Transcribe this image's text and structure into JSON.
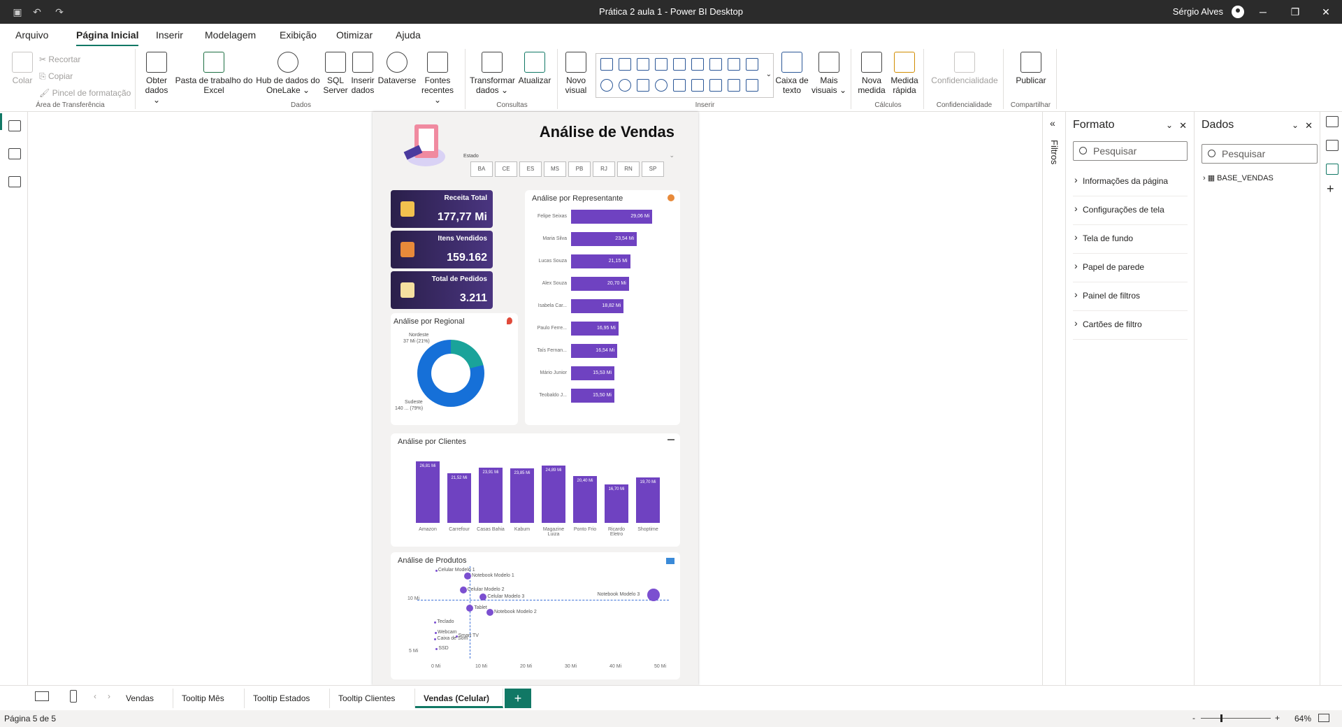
{
  "window": {
    "title": "Prática 2 aula 1 - Power BI Desktop",
    "user": "Sérgio Alves"
  },
  "menu": [
    "Arquivo",
    "Página Inicial",
    "Inserir",
    "Modelagem",
    "Exibição",
    "Otimizar",
    "Ajuda"
  ],
  "ribbon": {
    "clipboard": {
      "colar": "Colar",
      "recortar": "Recortar",
      "copiar": "Copiar",
      "pincel": "Pincel de formatação",
      "label": "Área de Transferência"
    },
    "dados": {
      "obter": "Obter dados ⌄",
      "excel": "Pasta de trabalho do Excel",
      "onelake": "Hub de dados do OneLake ⌄",
      "sql": "SQL Server",
      "inserir": "Inserir dados",
      "dataverse": "Dataverse",
      "fontes": "Fontes recentes ⌄",
      "label": "Dados"
    },
    "consultas": {
      "transformar": "Transformar dados ⌄",
      "atualizar": "Atualizar",
      "label": "Consultas"
    },
    "inserir": {
      "novo_visual": "Novo visual",
      "caixa": "Caixa de texto",
      "mais": "Mais visuais ⌄",
      "label": "Inserir"
    },
    "calculos": {
      "nova": "Nova medida",
      "rapida": "Medida rápida",
      "label": "Cálculos"
    },
    "confidencialidade": {
      "btn": "Confidencialidade",
      "label": "Confidencialidade"
    },
    "compartilhar": {
      "publicar": "Publicar",
      "label": "Compartilhar"
    }
  },
  "report": {
    "title": "Análise de Vendas",
    "estado_label": "Estado",
    "estados": [
      "BA",
      "CE",
      "ES",
      "MS",
      "PB",
      "RJ",
      "RN",
      "SP"
    ],
    "kpis": [
      {
        "label": "Receita Total",
        "value": "177,77 Mi"
      },
      {
        "label": "Itens Vendidos",
        "value": "159.162"
      },
      {
        "label": "Total de Pedidos",
        "value": "3.211"
      }
    ],
    "regional": {
      "title": "Análise por Regional",
      "nordeste_name": "Nordeste",
      "nordeste_value": "37 Mi (21%)",
      "sudeste_name": "Sudeste",
      "sudeste_value": "140 ... (79%)"
    },
    "representante": {
      "title": "Análise por Representante"
    },
    "clientes_title": "Análise por Clientes",
    "produtos": {
      "title": "Análise de Produtos",
      "y_ticks": [
        "10 Mi",
        "5 Mi"
      ],
      "x_ticks": [
        "0 Mi",
        "10 Mi",
        "20 Mi",
        "30 Mi",
        "40 Mi",
        "50 Mi"
      ],
      "points": [
        {
          "name": "Celular Modelo 1",
          "x": 0.5,
          "y": 17.0
        },
        {
          "name": "Notebook Modelo 1",
          "x": 7.5,
          "y": 16.2
        },
        {
          "name": "Celular Modelo 2",
          "x": 6.5,
          "y": 14.2
        },
        {
          "name": "Celular Modelo 3",
          "x": 11,
          "y": 13.2
        },
        {
          "name": "Tablet",
          "x": 8,
          "y": 11.6
        },
        {
          "name": "Notebook Modelo 2",
          "x": 12.5,
          "y": 11.0
        },
        {
          "name": "Notebook Modelo 3",
          "x": 49,
          "y": 13.5
        },
        {
          "name": "Teclado",
          "x": 0.3,
          "y": 9.6
        },
        {
          "name": "Webcam",
          "x": 0.4,
          "y": 8.1
        },
        {
          "name": "Smart TV",
          "x": 5,
          "y": 7.6
        },
        {
          "name": "Caixa de Som",
          "x": 0.3,
          "y": 7.2
        },
        {
          "name": "SSD",
          "x": 0.6,
          "y": 5.8
        }
      ]
    }
  },
  "chart_data": [
    {
      "type": "bar",
      "orientation": "horizontal",
      "title": "Análise por Representante",
      "categories": [
        "Felipe Seixas",
        "Maria Silva",
        "Lucas Souza",
        "Alex Souza",
        "Isabela Car...",
        "Paulo Ferre...",
        "Taís Fernan...",
        "Mário Junior",
        "Teobaldo J..."
      ],
      "values": [
        29.06,
        23.54,
        21.15,
        20.7,
        18.82,
        16.95,
        16.54,
        15.53,
        15.5
      ],
      "labels": [
        "29,06 Mi",
        "23,54 Mi",
        "21,15 Mi",
        "20,70 Mi",
        "18,82 Mi",
        "16,95 Mi",
        "16,54 Mi",
        "15,53 Mi",
        "15,50 Mi"
      ]
    },
    {
      "type": "bar",
      "title": "Análise por Clientes",
      "categories": [
        "Amazon",
        "Carrefour",
        "Casas Bahia",
        "Kabum",
        "Magazine Luiza",
        "Ponto Frio",
        "Ricardo Eletro",
        "Shoptime"
      ],
      "values": [
        26.81,
        21.52,
        23.91,
        23.85,
        24.89,
        20.4,
        16.7,
        19.7
      ],
      "labels": [
        "26,81 Mi",
        "21,52 Mi",
        "23,91 Mi",
        "23,85 Mi",
        "24,89 Mi",
        "20,40 Mi",
        "16,70 Mi",
        "19,70 Mi"
      ]
    },
    {
      "type": "pie",
      "title": "Análise por Regional",
      "categories": [
        "Nordeste",
        "Sudeste"
      ],
      "values": [
        37,
        140
      ],
      "percent": [
        21,
        79
      ]
    }
  ],
  "panes": {
    "filtros": "Filtros",
    "formato": {
      "title": "Formato",
      "search": "Pesquisar",
      "items": [
        "Informações da página",
        "Configurações de tela",
        "Tela de fundo",
        "Papel de parede",
        "Painel de filtros",
        "Cartões de filtro"
      ]
    },
    "dados": {
      "title": "Dados",
      "search": "Pesquisar",
      "table": "BASE_VENDAS"
    }
  },
  "tabs": [
    "Vendas",
    "Tooltip Mês",
    "Tooltip Estados",
    "Tooltip Clientes",
    "Vendas (Celular)"
  ],
  "status": {
    "page": "Página 5 de 5",
    "zoom": "64%"
  },
  "colors": {
    "accent": "#117865",
    "bar": "#6f42c1",
    "donut_nordeste": "#1aa39a",
    "donut_sudeste": "#1670d8"
  }
}
